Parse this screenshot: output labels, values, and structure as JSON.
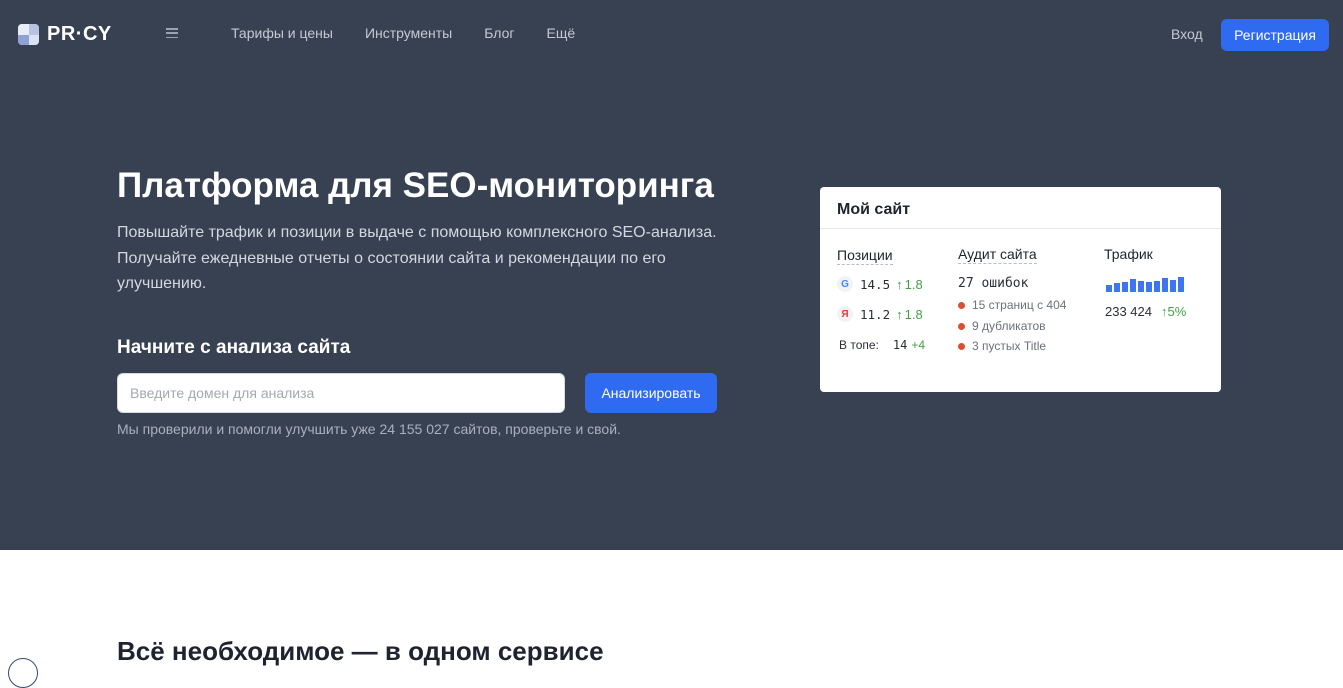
{
  "header": {
    "logo_text": "PR·CY",
    "menu_icon": "hamburger-icon",
    "nav": [
      {
        "label": "Тарифы и цены"
      },
      {
        "label": "Инструменты"
      },
      {
        "label": "Блог"
      },
      {
        "label": "Ещё"
      }
    ],
    "login_label": "Вход",
    "register_label": "Регистрация"
  },
  "hero": {
    "title": "Платформа для SEO-мониторинга",
    "subtitle": "Повышайте трафик и позиции в выдаче с помощью комплексного SEO-анализа. Получайте ежедневные отчеты о состоянии сайта и рекомендации по его улучшению.",
    "start_title": "Начните с анализа сайта",
    "input_placeholder": "Введите домен для анализа",
    "analyze_label": "Анализировать",
    "checked_note": "Мы проверили и помогли улучшить уже 24 155 027 сайтов, проверьте и свой."
  },
  "card": {
    "title": "Мой сайт",
    "positions": {
      "header": "Позиции",
      "google": {
        "icon_letter": "G",
        "value": "14.5",
        "delta": "1.8"
      },
      "yandex": {
        "icon_letter": "Я",
        "value": "11.2",
        "delta": "1.8"
      },
      "top_label": "В топе:",
      "top_value": "14",
      "top_delta": "+4"
    },
    "audit": {
      "header": "Аудит сайта",
      "errors": "27  ошибок",
      "items": [
        {
          "text": "15 страниц с 404"
        },
        {
          "text": "9 дубликатов"
        },
        {
          "text": "3 пустых Title"
        }
      ]
    },
    "traffic": {
      "header": "Трафик",
      "bars": [
        0.45,
        0.6,
        0.65,
        0.85,
        0.7,
        0.65,
        0.75,
        0.9,
        0.8,
        1.0
      ],
      "value": "233 424",
      "delta": "5%"
    }
  },
  "section": {
    "title": "Всё необходимое — в одном сервисе"
  },
  "colors": {
    "hero_bg": "#374151",
    "accent": "#2f6bf0",
    "positive": "#43a047",
    "error_dot": "#d9502e"
  }
}
